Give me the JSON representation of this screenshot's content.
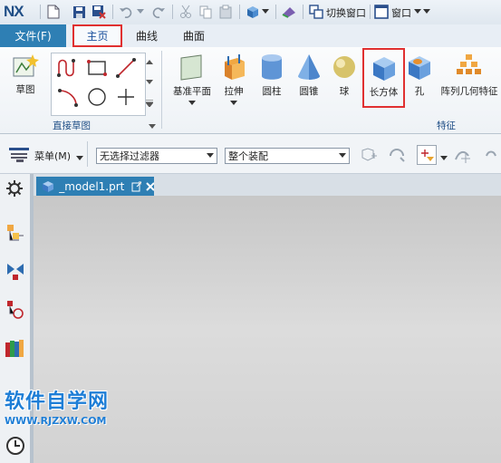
{
  "titlebar": {
    "app_logo": "NX",
    "switch_window_label": "切换窗口",
    "window_label": "窗口"
  },
  "ribbon": {
    "tabs": [
      {
        "label": "文件(F)"
      },
      {
        "label": "主页"
      },
      {
        "label": "曲线"
      },
      {
        "label": "曲面"
      }
    ],
    "sketch_label": "草图",
    "direct_sketch_group": "直接草图",
    "feature_group": "特征",
    "features": [
      {
        "label": "基准平面"
      },
      {
        "label": "拉伸"
      },
      {
        "label": "圆柱"
      },
      {
        "label": "圆锥"
      },
      {
        "label": "球"
      },
      {
        "label": "长方体"
      },
      {
        "label": "孔"
      },
      {
        "label": "阵列几何特征"
      }
    ]
  },
  "toolbar2": {
    "menu_label": "菜单(M)",
    "filter_value": "无选择过滤器",
    "assembly_value": "整个装配"
  },
  "document": {
    "tab_label": "_model1.prt"
  },
  "watermark": {
    "main": "软件自学网",
    "sub": "WWW.RJZXW.COM"
  },
  "colors": {
    "accent_blue": "#2e7fb4",
    "highlight_red": "#e03030",
    "canvas_gray": "#d2d2d2"
  }
}
